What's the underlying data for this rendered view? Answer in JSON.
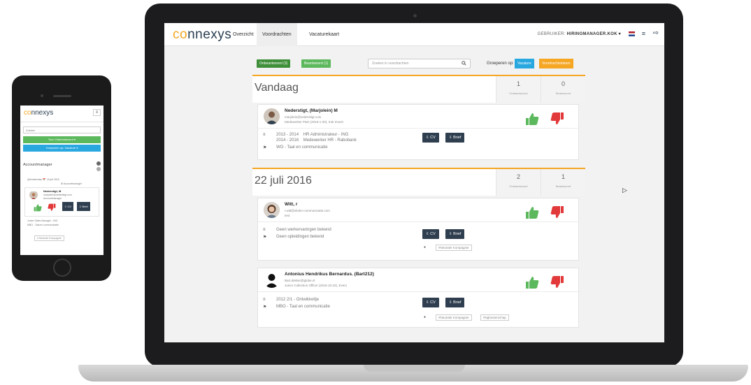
{
  "app": {
    "logo_prefix": "co",
    "logo_suffix": "nnexys",
    "nav": [
      {
        "label": "Overzicht"
      },
      {
        "label": "Voordrachten"
      },
      {
        "label": "Vacaturekaart"
      }
    ],
    "user_prefix": "GEBRUIKER: ",
    "user_name": "HIRINGMANAGER.KOK ▾",
    "hamburger_icon": "≡",
    "logout_icon": "⇨"
  },
  "toolbar": {
    "filter_unanswered": "Onbeantwoord (3)",
    "filter_answered": "Beantwoord (1)",
    "search_placeholder": "Zoeken in voordrachten",
    "search_icon": "🔍",
    "group_label": "Groeperen op:",
    "group_vacancy": "Vacature",
    "group_date": "Voordrachtsdatum",
    "colors": {
      "green": "#5cb85c",
      "green_dark": "#3f8f3a",
      "blue": "#29a8e0",
      "orange": "#f5a623"
    }
  },
  "sections": [
    {
      "date": "Vandaag",
      "unanswered_count": "1",
      "unanswered_label": "Onbeantwoord",
      "answered_count": "0",
      "answered_label": "Beantwoord"
    },
    {
      "date": "22 juli 2016",
      "unanswered_count": "2",
      "unanswered_label": "Onbeantwoord",
      "answered_count": "1",
      "answered_label": "Beantwoord"
    }
  ],
  "candidates": [
    {
      "name": "Nederstigt, (Marjolein) M",
      "email": "marjolein@nederstigt.com",
      "role": "Medewerker P&O (2016-1-30), Kok Invest",
      "work": "2013 - 2014    HR Administrateur - ING\n2014 - 2016    Medewerker HR - Rabobank",
      "education": "WO - Taal en communicatie",
      "tags": []
    },
    {
      "name": "Witt, r",
      "email": "r.witt@vbvbn-communicatie.com",
      "role": "test",
      "work": "Geen werkervaringen bekend",
      "education": "Geen opleidingen bekend",
      "tags": [
        "#Neutrale Kompagnie"
      ]
    },
    {
      "name": "Antonius Hendrikus Bernardus. (Bart212)",
      "email": "Bart.dekker@globe.nl",
      "role": "Junior Collection Officer (2016-10-22), Evers",
      "work": "2012          2/1 - Ontwikkeltje",
      "education": "MBO - Taal en communicatie",
      "tags": [
        "#Neutrale Kompagnie",
        "#Nghesterschap"
      ]
    }
  ],
  "buttons": {
    "cv": "⇩ CV",
    "letter": "⇩ Brief"
  },
  "icons": {
    "thumbs_up": "thumbs-up-icon",
    "thumbs_down": "thumbs-down-icon",
    "work": "≡",
    "education": "⚑",
    "tag": "●"
  },
  "mobile": {
    "logo_prefix": "co",
    "logo_suffix": "nnexys",
    "menu_icon": "≡",
    "search_value": "Zoeken",
    "toon_btn": "Toon Onbeantwoord ▾",
    "group_btn": "Groeperen op: Vacature ▾",
    "section_title": "Accountmanager",
    "section_meta": "@Amsterdam    📅 15 juli 2016",
    "section_meta2": "⊞ Accountmanager",
    "card_name": "Nederstigt, M",
    "card_email": "marjolein@nederstigt.com",
    "card_role": "Accountmanager",
    "cv": "⇩ CV",
    "letter": "⇩ Brief",
    "work": "Junior Sales Manager - ING",
    "education": "MBO - Taal en communicatie",
    "tag": "# Neutrale Kompagnie"
  }
}
